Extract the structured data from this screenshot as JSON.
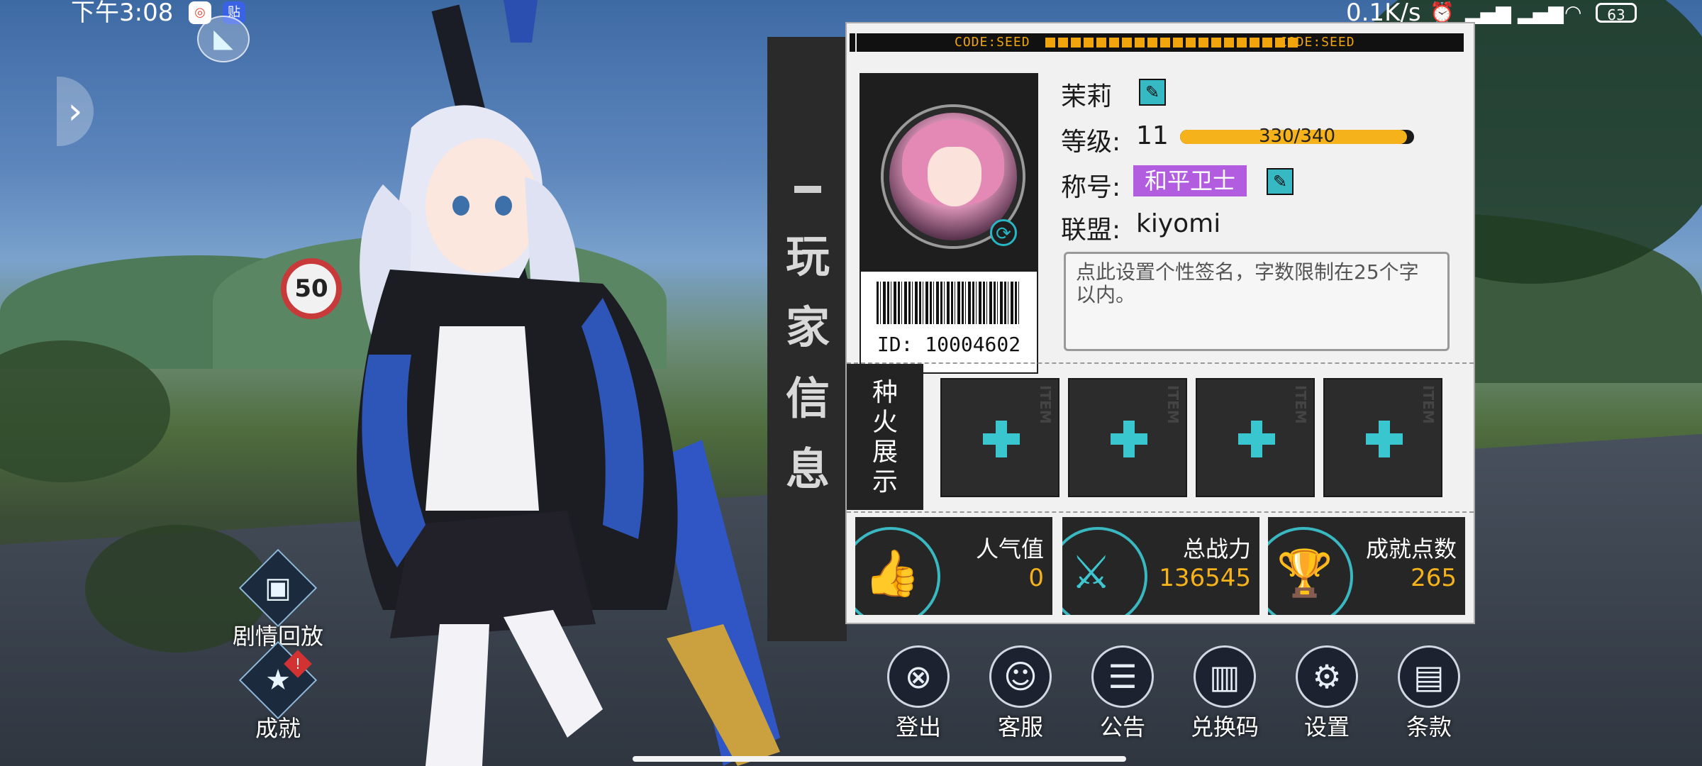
{
  "status_bar": {
    "time": "下午3:08",
    "app_icons": [
      "app-icon-1",
      "贴"
    ],
    "net_speed": "0.1K/s",
    "battery": "63"
  },
  "side_buttons": [
    {
      "label": "剧情回放",
      "icon": "film-icon"
    },
    {
      "label": "成就",
      "icon": "star-icon",
      "badge": "!"
    }
  ],
  "banner": {
    "vertical_text": "玩家信息"
  },
  "panel": {
    "code_left": "CODE:SEED",
    "code_right": "CODE:SEED",
    "player_id": "ID: 10004602",
    "name": "茉莉",
    "level_label": "等级:",
    "level_value": "11",
    "xp_text": "330/340",
    "xp_fraction": 0.97,
    "title_label": "称号:",
    "title_value": "和平卫士",
    "alliance_label": "联盟:",
    "alliance_value": "kiyomi",
    "signature_placeholder": "点此设置个性签名，字数限制在25个字以内。",
    "spark_label": [
      "种",
      "火",
      "展",
      "示"
    ],
    "slot_tag": "ITEM",
    "stats": [
      {
        "label": "人气值",
        "value": "0",
        "icon": "thumbs-up-icon"
      },
      {
        "label": "总战力",
        "value": "136545",
        "icon": "crossed-swords-icon"
      },
      {
        "label": "成就点数",
        "value": "265",
        "icon": "trophy-icon"
      }
    ]
  },
  "bottom_buttons": [
    {
      "label": "登出",
      "icon": "logout-icon"
    },
    {
      "label": "客服",
      "icon": "headset-icon"
    },
    {
      "label": "公告",
      "icon": "notice-icon"
    },
    {
      "label": "兑换码",
      "icon": "barcode-scan-icon"
    },
    {
      "label": "设置",
      "icon": "gear-icon"
    },
    {
      "label": "条款",
      "icon": "document-icon"
    }
  ],
  "colors": {
    "accent": "#39c6cf",
    "gold": "#f5b21a",
    "title_badge": "#b25de0"
  }
}
